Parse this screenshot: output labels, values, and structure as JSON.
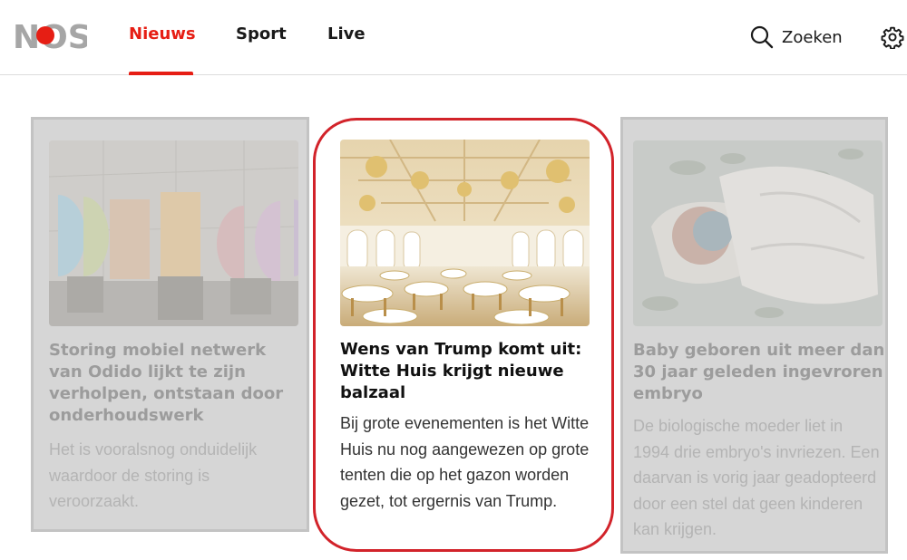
{
  "header": {
    "logo_text": "NOS",
    "nav": [
      {
        "label": "Nieuws",
        "active": true
      },
      {
        "label": "Sport",
        "active": false
      },
      {
        "label": "Live",
        "active": false
      }
    ],
    "search_label": "Zoeken",
    "accent_color": "#e61e14"
  },
  "cards": [
    {
      "title": "Storing mobiel netwerk van Odido lijkt te zijn verholpen, ontstaan door onderhoudswerk",
      "description": "Het is vooralsnog onduidelijk waardoor de storing is veroorzaakt.",
      "image": "odido-logo-letters-image",
      "state": "dimmed"
    },
    {
      "title": "Wens van Trump komt uit: Witte Huis krijgt nieuwe balzaal",
      "description": "Bij grote evenementen is het Witte Huis nu nog aangewezen op grote tenten die op het gazon worden gezet, tot ergernis van Trump.",
      "image": "ballroom-rendering-image",
      "state": "highlighted"
    },
    {
      "title": "Baby geboren uit meer dan 30 jaar geleden ingevroren embryo",
      "description": "De biologische moeder liet in 1994 drie embryo's invriezen. Een daarvan is vorig jaar geadopteerd door een stel dat geen kinderen kan krijgen.",
      "image": "swaddled-baby-image",
      "state": "dimmed"
    }
  ],
  "icons": {
    "search": "search-icon",
    "settings": "gear-icon"
  }
}
